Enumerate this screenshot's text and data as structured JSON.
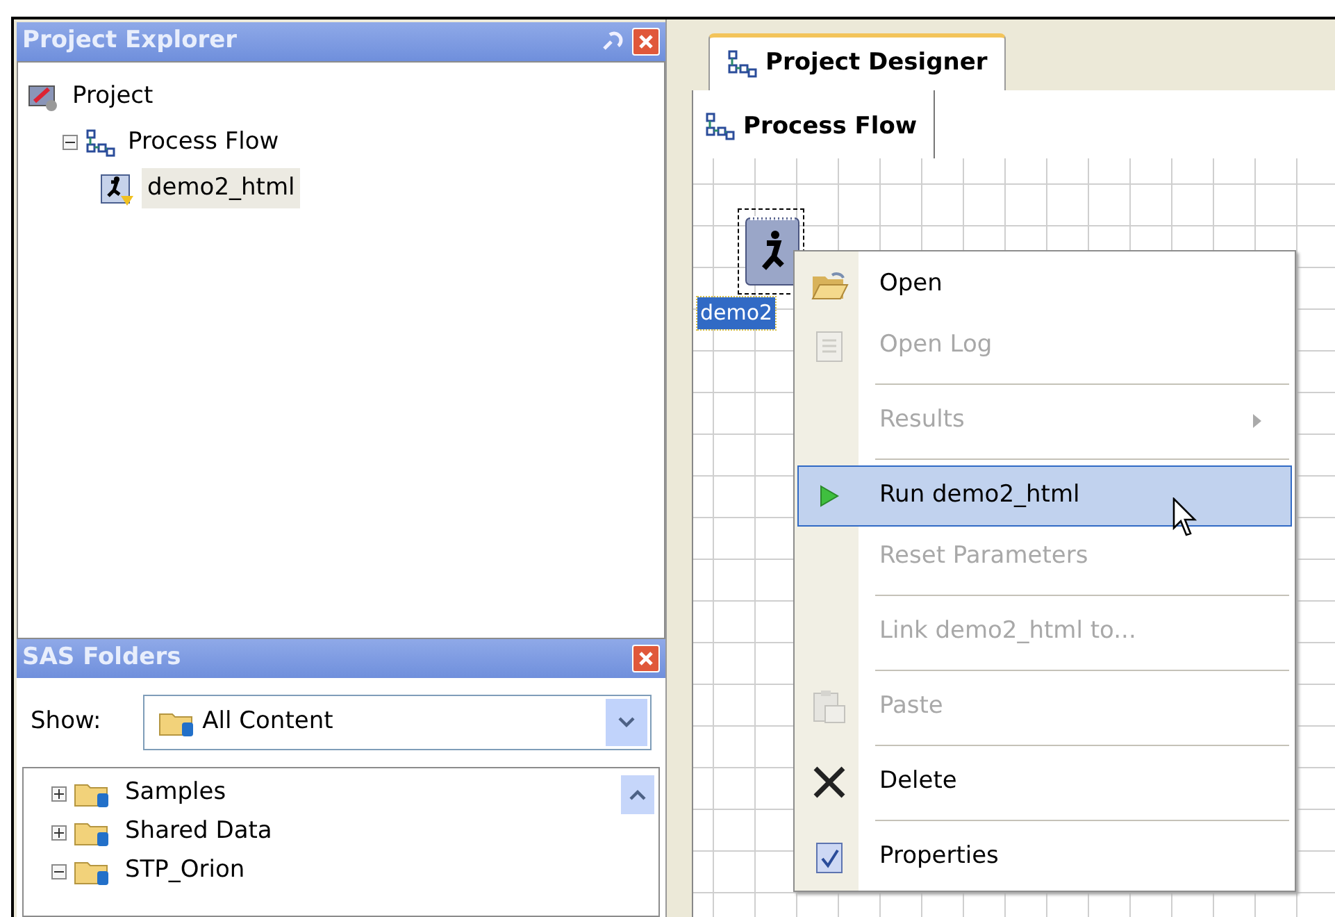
{
  "project_explorer": {
    "title": "Project Explorer",
    "tree": [
      {
        "label": "Project",
        "kind": "project",
        "selected": false,
        "children": [
          {
            "label": "Process Flow",
            "kind": "flow",
            "selected": false,
            "expanded": true,
            "children": [
              {
                "label": "demo2_html",
                "kind": "task",
                "selected": true
              }
            ]
          }
        ]
      }
    ]
  },
  "sas_folders": {
    "title": "SAS Folders",
    "show_label": "Show:",
    "show_value": "All Content",
    "tree": [
      {
        "label": "Samples",
        "expanded": false
      },
      {
        "label": "Shared Data",
        "expanded": false
      },
      {
        "label": "STP_Orion",
        "expanded": true
      }
    ]
  },
  "designer": {
    "tabs": [
      {
        "label": "Project Designer",
        "selected": true
      }
    ],
    "subtabs": [
      {
        "label": "Process Flow",
        "selected": true
      }
    ],
    "nodes": [
      {
        "label": "demo2",
        "selected": true
      }
    ]
  },
  "context_menu": {
    "items": [
      {
        "kind": "open",
        "label": "Open",
        "disabled": false,
        "selected": false
      },
      {
        "kind": "log",
        "label": "Open Log",
        "disabled": true,
        "selected": false
      },
      {
        "kind": "separator"
      },
      {
        "kind": "plain",
        "label": "Results",
        "submenu": true,
        "disabled": true,
        "selected": false
      },
      {
        "kind": "separator"
      },
      {
        "kind": "run",
        "label": "Run demo2_html",
        "disabled": false,
        "selected": true
      },
      {
        "kind": "plain",
        "label": "Reset Parameters",
        "disabled": true,
        "selected": false
      },
      {
        "kind": "separator"
      },
      {
        "kind": "plain",
        "label": "Link demo2_html to...",
        "disabled": true,
        "selected": false
      },
      {
        "kind": "separator"
      },
      {
        "kind": "paste",
        "label": "Paste",
        "disabled": true,
        "selected": false
      },
      {
        "kind": "separator"
      },
      {
        "kind": "delete",
        "label": "Delete",
        "disabled": false,
        "selected": false
      },
      {
        "kind": "separator"
      },
      {
        "kind": "properties",
        "label": "Properties",
        "disabled": false,
        "selected": false
      }
    ]
  }
}
